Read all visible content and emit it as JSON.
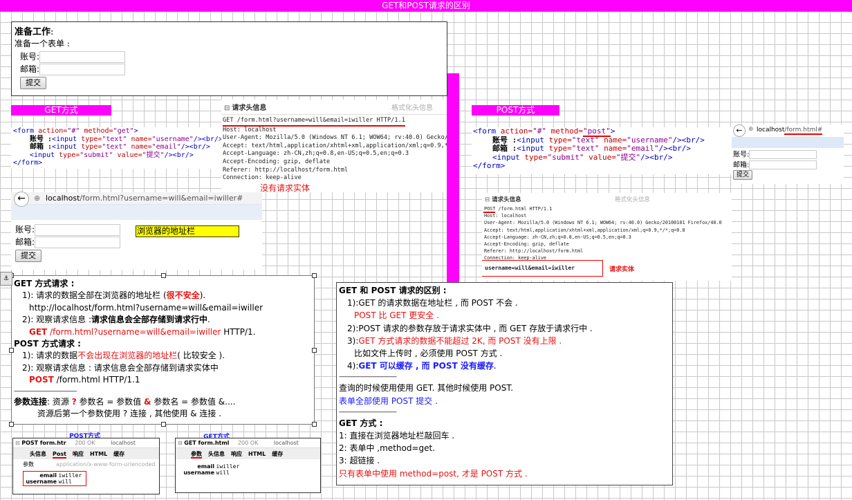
{
  "title": "GET和POST请求的区别",
  "prep": {
    "heading": "准备工作",
    "colon": ":",
    "subtitle": "准备一个表单 :",
    "account_label": "账号:",
    "email_label": "邮箱:",
    "submit_label": "提交"
  },
  "get_label": "GET方式",
  "post_label": "POST方式",
  "get_code": {
    "open_tag": "<form",
    "action_attr": "action=",
    "action_val": "\"#\"",
    "method_attr": "method=",
    "method_val": "\"get\"",
    "close": ">",
    "line2_label": "账号 :",
    "line2_tag": "<input",
    "line2_type_attr": "type=",
    "line2_type_val": "\"text\"",
    "line2_name_attr": "name=",
    "line2_name_val": "\"username\"",
    "line2_end": "/><br/>",
    "line3_label": "邮箱 :",
    "line3_tag": "<input",
    "line3_type_attr": "type=",
    "line3_type_val": "\"text\"",
    "line3_name_attr": "name=",
    "line3_name_val": "\"email\"",
    "line3_end": "/><br/>",
    "line4_tag": "<input",
    "line4_type_attr": "type=",
    "line4_type_val": "\"submit\"",
    "line4_value_attr": "value=",
    "line4_value_val": "\"提交\"",
    "line4_end": "/><br/>",
    "end_tag": "</form>"
  },
  "post_code": {
    "open_tag": "<form",
    "action_attr": "action=",
    "action_val": "\"#\"",
    "method_attr": "method=",
    "method_val": "\"post\"",
    "close": ">",
    "line2_label": "账号 :",
    "line2_tag": "<input",
    "line2_type_attr": "type=",
    "line2_type_val": "\"text\"",
    "line2_name_attr": "name=",
    "line2_name_val": "\"username\"",
    "line2_end": "/><br/>",
    "line3_label": "邮箱 :",
    "line3_tag": "<input",
    "line3_type_attr": "type=",
    "line3_type_val": "\"text\"",
    "line3_name_attr": "name=",
    "line3_name_val": "\"email\"",
    "line3_end": "/><br/>",
    "line4_tag": "<input",
    "line4_type_attr": "type=",
    "line4_type_val": "\"submit\"",
    "line4_value_attr": "value=",
    "line4_value_val": "\"提交\"",
    "line4_end": "/><br/>",
    "end_tag": "</form>"
  },
  "get_headers": {
    "title": "请求头信息",
    "format_label": "格式化头信息",
    "lines": [
      "GET /form.html?username=will&email=iwiller HTTP/1.1",
      "Host: localhost",
      "User-Agent: Mozilla/5.0 (Windows NT 6.1; WOW64; rv:40.0) Gecko/",
      "Accept: text/html,application/xhtml+xml,application/xml;q=0.9,*/",
      "Accept-Language: zh-CN,zh;q=0.8,en-US;q=0.5,en;q=0.3",
      "Accept-Encoding: gzip, deflate",
      "Referer: http://localhost/form.html",
      "Connection: keep-alive"
    ],
    "no_body_note": "没有请求实体"
  },
  "post_headers": {
    "title": "请求头信息",
    "format_label": "格式化头信息",
    "lines": [
      "POST /form.html HTTP/1.1",
      "Host: localhost",
      "User-Agent: Mozilla/5.0 (Windows NT 6.1; WOW64; rv:40.0) Gecko/20100101 Firefox/40.0",
      "Accept: text/html,application/xhtml+xml,application/xml;q=0.9,*/*;q=0.8",
      "Accept-Language: zh-CN,zh;q=0.8,en-US;q=0.5,en;q=0.3",
      "Accept-Encoding: gzip, deflate",
      "Referer: http://localhost/form.html",
      "Connection: keep-alive"
    ],
    "body": "username=will&email=iwiller",
    "body_note": "请求实体"
  },
  "get_browser": {
    "url_host": "localhost",
    "url_path": "/form.html?username=will&email=iwiller#",
    "account_label": "账号:",
    "email_label": "邮箱:",
    "submit_label": "提交",
    "note": "浏览器的地址栏"
  },
  "post_browser": {
    "url_host": "localhost",
    "url_path": "/form.html#",
    "account_label": "账号:",
    "email_label": "邮箱:",
    "submit_label": "提交"
  },
  "notes_left": {
    "get_title": "GET 方式请求 :",
    "g1_pre": "1): 请求的数据全部在浏览器的地址栏 (",
    "g1_red": "很不安全",
    "g1_post": ").",
    "g1_url": "http://localhost/form.html?username=will&email=iwiller",
    "g2_pre": "2): 观察请求信息 :",
    "g2_bold": "请求信息会全部存储到请求行中",
    "g2_post": ".",
    "g2_get": "GET",
    "g2_url": "/form.html?username=will&email=iwiller",
    "g2_http": "HTTP/1.",
    "post_title": "POST 方式请求 :",
    "p1_pre": "1): 请求的数据",
    "p1_red": "不会出现在浏览器的地址栏",
    "p1_post": "( 比较安全 ).",
    "p2_text": "2): 观察请求信息 : 请求信息会全部存储到请求实体中",
    "p2_post": "POST",
    "p2_rest": "/form.html HTTP/1.1",
    "divider": "------------------------------------------------",
    "params_bold": "参数连接",
    "params_pre": ": 资源",
    "params_q": "?",
    "params_mid": "参数名 = 参数值",
    "params_amp": "&",
    "params_end": "参数名 = 参数值 &....",
    "params_line2": "资源后第一个参数使用 ? 连接 , 其他使用 & 连接 ."
  },
  "notes_right": {
    "title": "GET 和 POST 请求的区别 :",
    "r1": "1):GET 的请求数据在地址栏 , 而 POST 不会 .",
    "r1b": "POST 比 GET 更安全 .",
    "r2": "2):POST 请求的参数存放于请求实体中 , 而 GET 存放于请求行中 .",
    "r3_pre": "3):",
    "r3_red": "GET 方式请求的数据不能超过 2K, 而 POST 没有上限 .",
    "r3b": "比如文件上传时 , 必须使用 POST 方式 .",
    "r4_pre": "4):",
    "r4_blue": "GET 可以缓存 , 而 POST 没有缓存",
    "r4_post": ".",
    "divider": "--------------------------------------------",
    "q1": "查询的时候使用使用 GET. 其他时候使用 POST.",
    "q2": "表单全部使用 POST 提交 .",
    "g_title": "GET 方式 :",
    "g1": "1: 直接在浏览器地址栏敲回车 .",
    "g2": "2: 表单中 ,method=get.",
    "g3": "3: 超链接 .",
    "g4": "只有表单中使用 method=post, 才是 POST 方式 ."
  },
  "post_mini": {
    "caption": "POST方式",
    "title": "POST form.htr",
    "status": "200 OK",
    "host": "localhost",
    "tabs": [
      "头信息",
      "Post",
      "响应",
      "HTML",
      "缓存"
    ],
    "param_label": "参数",
    "content_type": "application/x-www-form-urlencoded",
    "rows": [
      {
        "name": "email",
        "value": "iwiller"
      },
      {
        "name": "username",
        "value": "will"
      }
    ]
  },
  "get_mini": {
    "caption": "GET方式",
    "title": "GET form.html",
    "status": "200 OK",
    "host": "localhost",
    "tabs": [
      "参数",
      "头信息",
      "响应",
      "HTML",
      "缓存"
    ],
    "rows": [
      {
        "name": "email",
        "value": "iwiller"
      },
      {
        "name": "username",
        "value": "will"
      }
    ]
  }
}
